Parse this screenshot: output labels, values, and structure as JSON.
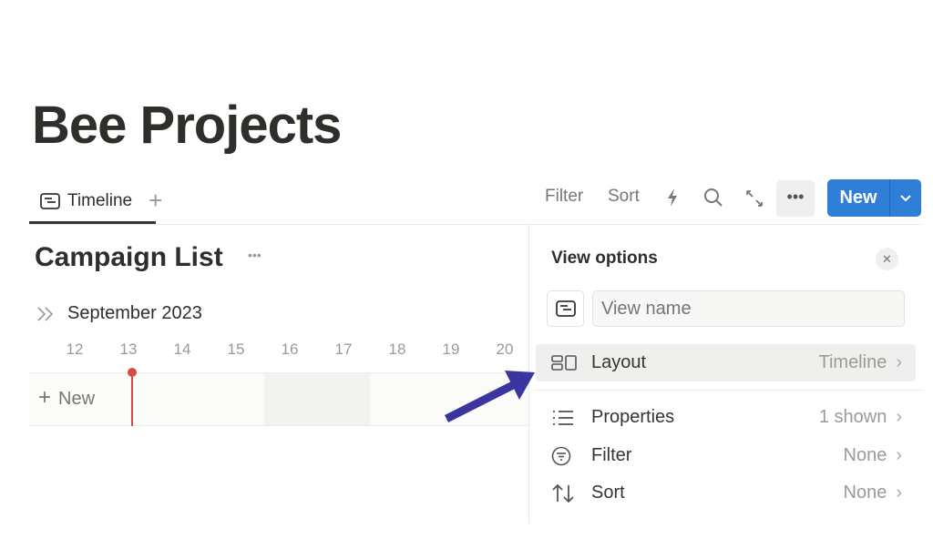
{
  "page_title": "Bee Projects",
  "tabs": [
    {
      "label": "Timeline",
      "icon": "timeline-icon"
    }
  ],
  "add_view": "+",
  "toolbar": {
    "filter": "Filter",
    "sort": "Sort",
    "more": "•••",
    "new": "New",
    "new_dropdown": "⌄"
  },
  "view": {
    "title": "Campaign List",
    "menu": "•••",
    "month": "September 2023",
    "days": [
      "12",
      "13",
      "14",
      "15",
      "16",
      "17",
      "18",
      "19",
      "20"
    ],
    "new_row": "New",
    "today": "13"
  },
  "view_options": {
    "title": "View options",
    "close": "✕",
    "name_placeholder": "View name",
    "items": [
      {
        "label": "Layout",
        "value": "Timeline",
        "icon": "layout-icon"
      },
      {
        "label": "Properties",
        "value": "1 shown",
        "icon": "list-icon"
      },
      {
        "label": "Filter",
        "value": "None",
        "icon": "filter-icon"
      },
      {
        "label": "Sort",
        "value": "None",
        "icon": "sort-icon"
      }
    ]
  },
  "colors": {
    "accent": "#2f7fd8",
    "today": "#d44c47",
    "arrow": "#3b35a0"
  }
}
